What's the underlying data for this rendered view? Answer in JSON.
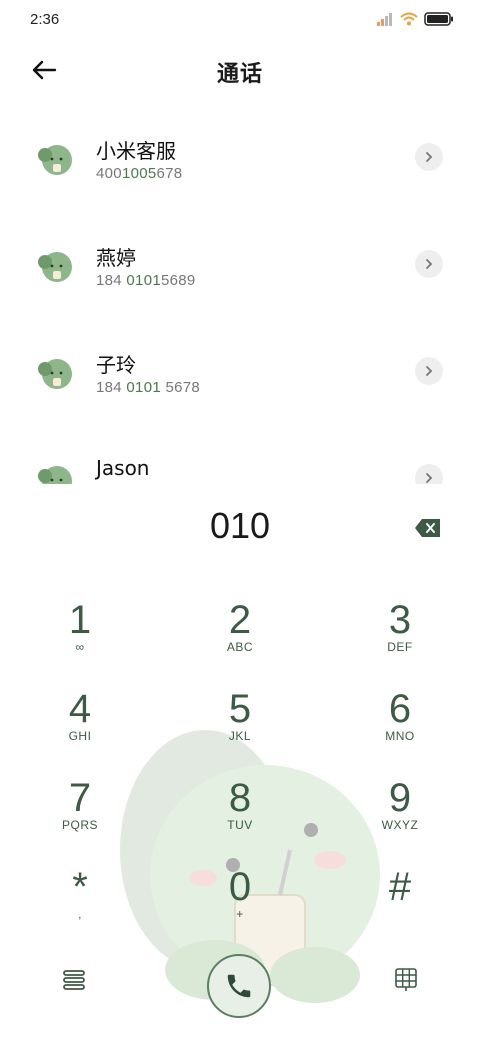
{
  "status_bar": {
    "time": "2:36"
  },
  "header": {
    "title": "通话"
  },
  "contacts": [
    {
      "name": "小米客服",
      "num_pre": "400",
      "num_hl": "1005",
      "num_post": "678"
    },
    {
      "name": "燕婷",
      "num_pre": "184 ",
      "num_hl": "0101",
      "num_post": "5689"
    },
    {
      "name": "子玲",
      "num_pre": "184 ",
      "num_hl": "0101",
      "num_post": " 5678"
    },
    {
      "name": "Jason",
      "num_pre": "",
      "num_hl": "",
      "num_post": ""
    }
  ],
  "dialer": {
    "input": "010",
    "keys": [
      {
        "digit": "1",
        "letters": "∞"
      },
      {
        "digit": "2",
        "letters": "ABC"
      },
      {
        "digit": "3",
        "letters": "DEF"
      },
      {
        "digit": "4",
        "letters": "GHI"
      },
      {
        "digit": "5",
        "letters": "JKL"
      },
      {
        "digit": "6",
        "letters": "MNO"
      },
      {
        "digit": "7",
        "letters": "PQRS"
      },
      {
        "digit": "8",
        "letters": "TUV"
      },
      {
        "digit": "9",
        "letters": "WXYZ"
      },
      {
        "digit": "*",
        "letters": ","
      },
      {
        "digit": "0",
        "letters": "+"
      },
      {
        "digit": "#",
        "letters": ""
      }
    ]
  },
  "colors": {
    "accent": "#3c5a44",
    "highlight": "#4c7a4c",
    "avatar": "#8fb58a"
  },
  "icons": [
    "back-arrow-icon",
    "chevron-right-icon",
    "backspace-icon",
    "menu-icon",
    "phone-icon",
    "dialpad-icon"
  ]
}
